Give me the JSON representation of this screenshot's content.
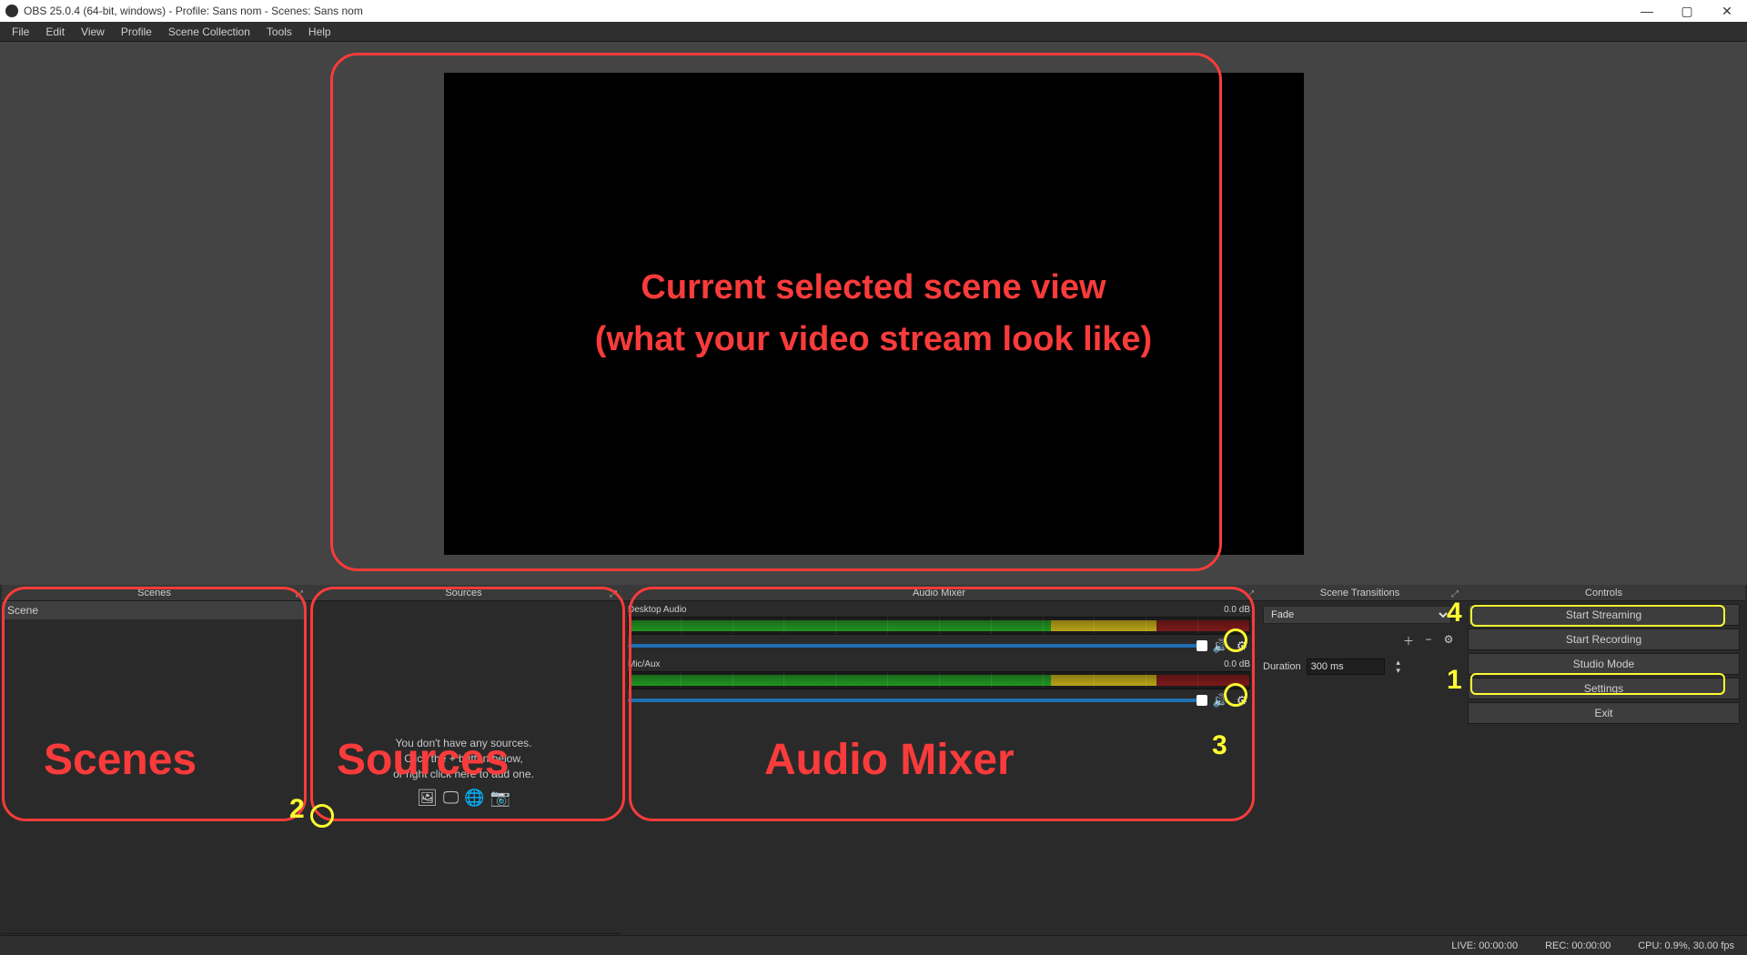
{
  "window": {
    "title": "OBS 25.0.4 (64-bit, windows) - Profile: Sans nom - Scenes: Sans nom"
  },
  "menu": {
    "file": "File",
    "edit": "Edit",
    "view": "View",
    "profile": "Profile",
    "scene_collection": "Scene Collection",
    "tools": "Tools",
    "help": "Help"
  },
  "preview": {
    "overlay_line1": "Current selected scene view",
    "overlay_line2": "(what your video stream look like)"
  },
  "scenes": {
    "title": "Scenes",
    "items": [
      {
        "name": "Scene"
      }
    ],
    "annotation_label": "Scenes"
  },
  "sources": {
    "title": "Sources",
    "empty_line1": "You don't have any sources.",
    "empty_line2": "Click the + button below,",
    "empty_line3": "or right click here to add one.",
    "annotation_label": "Sources"
  },
  "mixer": {
    "title": "Audio Mixer",
    "channels": [
      {
        "name": "Desktop Audio",
        "level": "0.0 dB"
      },
      {
        "name": "Mic/Aux",
        "level": "0.0 dB"
      }
    ],
    "annotation_label": "Audio Mixer"
  },
  "transitions": {
    "title": "Scene Transitions",
    "current": "Fade",
    "duration_label": "Duration",
    "duration_value": "300 ms"
  },
  "controls": {
    "title": "Controls",
    "start_streaming": "Start Streaming",
    "start_recording": "Start Recording",
    "studio_mode": "Studio Mode",
    "settings": "Settings",
    "exit": "Exit"
  },
  "status": {
    "live": "LIVE: 00:00:00",
    "rec": "REC: 00:00:00",
    "cpu": "CPU: 0.9%, 30.00 fps"
  },
  "annotations": {
    "n1": "1",
    "n2": "2",
    "n3": "3",
    "n4": "4"
  }
}
